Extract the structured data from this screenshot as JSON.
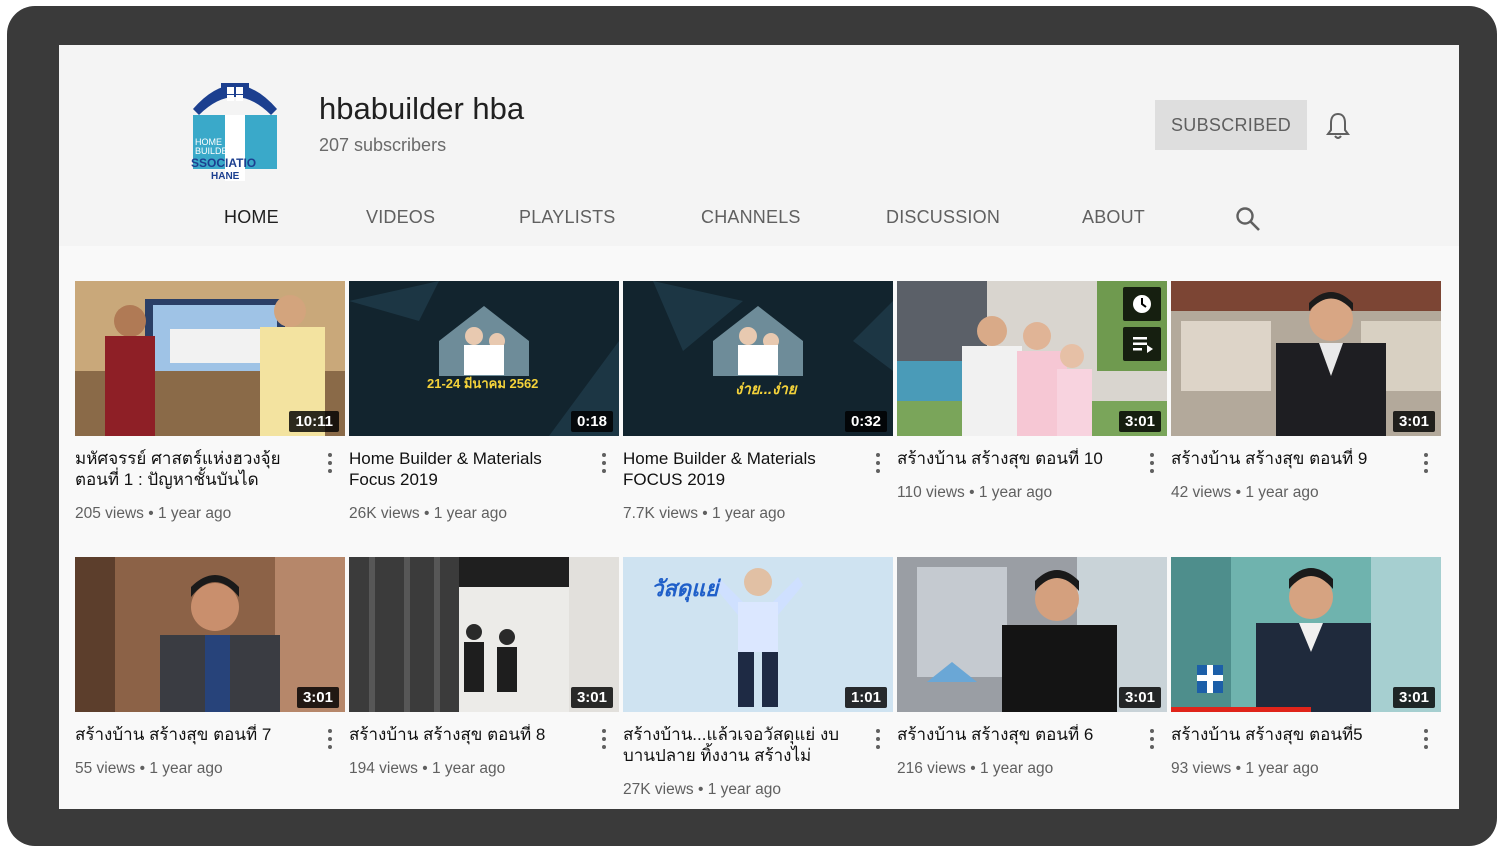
{
  "channel": {
    "name": "hbabuilder hba",
    "subscribers": "207 subscribers",
    "subscribe_label": "SUBSCRIBED",
    "logo_text_1": "HOME",
    "logo_text_2": "BUILDER",
    "logo_text_3": "SSOCIATIO",
    "logo_text_4": "HANE"
  },
  "tabs": [
    {
      "label": "HOME"
    },
    {
      "label": "VIDEOS"
    },
    {
      "label": "PLAYLISTS"
    },
    {
      "label": "CHANNELS"
    },
    {
      "label": "DISCUSSION"
    },
    {
      "label": "ABOUT"
    }
  ],
  "videos": [
    {
      "title": "มหัศจรรย์ ศาสตร์แห่งฮวงจุ้ย ตอนที่ 1 : ปัญหาชั้นบันได",
      "views": "205 views",
      "age": "1 year ago",
      "duration": "10:11"
    },
    {
      "title": "Home Builder & Materials Focus 2019",
      "views": "26K views",
      "age": "1 year ago",
      "duration": "0:18",
      "overlay": "21-24 มีนาคม 2562"
    },
    {
      "title": "Home Builder & Materials FOCUS 2019",
      "views": "7.7K views",
      "age": "1 year ago",
      "duration": "0:32",
      "overlay": "ง่าย...ง่าย"
    },
    {
      "title": "สร้างบ้าน สร้างสุข ตอนที่ 10",
      "views": "110 views",
      "age": "1 year ago",
      "duration": "3:01"
    },
    {
      "title": "สร้างบ้าน สร้างสุข ตอนที่ 9",
      "views": "42 views",
      "age": "1 year ago",
      "duration": "3:01"
    },
    {
      "title": "สร้างบ้าน สร้างสุข ตอนที่ 7",
      "views": "55 views",
      "age": "1 year ago",
      "duration": "3:01"
    },
    {
      "title": "สร้างบ้าน สร้างสุข ตอนที่ 8",
      "views": "194 views",
      "age": "1 year ago",
      "duration": "3:01"
    },
    {
      "title": "สร้างบ้าน...แล้วเจอวัสดุแย่ งบบานปลาย ทิ้งงาน สร้างไม่เสร็จ...",
      "views": "27K views",
      "age": "1 year ago",
      "duration": "1:01",
      "overlay": "วัสดุแย่"
    },
    {
      "title": "สร้างบ้าน สร้างสุข ตอนที่ 6",
      "views": "216 views",
      "age": "1 year ago",
      "duration": "3:01"
    },
    {
      "title": "สร้างบ้าน สร้างสุข ตอนที่5",
      "views": "93 views",
      "age": "1 year ago",
      "duration": "3:01",
      "progress": 0.52
    }
  ],
  "separator": "•",
  "colors": {
    "accent": "#e0241a",
    "logo_blue": "#1c3f8f",
    "logo_teal": "#3aa9c9"
  }
}
